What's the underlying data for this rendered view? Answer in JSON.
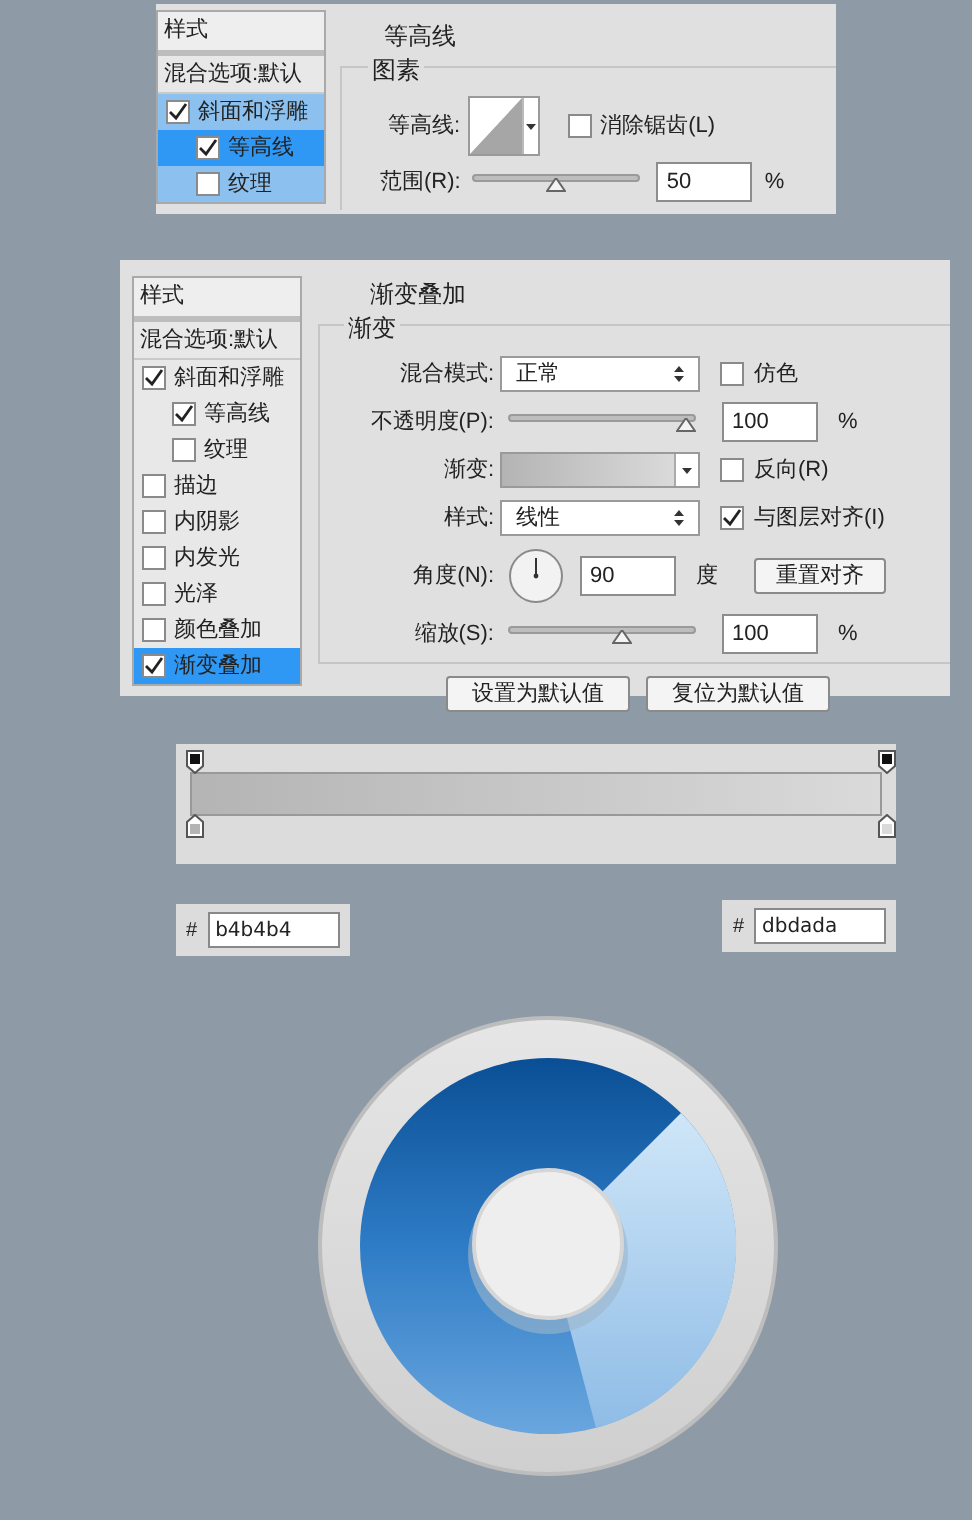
{
  "contour_panel": {
    "sidebar": [
      {
        "kind": "header",
        "label": "样式"
      },
      {
        "kind": "plain",
        "label": "混合选项:默认"
      },
      {
        "kind": "check",
        "label": "斜面和浮雕",
        "checked": true,
        "selected": false,
        "children": [
          {
            "kind": "check",
            "label": "等高线",
            "checked": true,
            "selected": true
          },
          {
            "kind": "check",
            "label": "纹理",
            "checked": false,
            "selected": false
          }
        ]
      }
    ],
    "title": "等高线",
    "group": "图素",
    "contour_label": "等高线:",
    "antialias": {
      "label": "消除锯齿(L)",
      "checked": false
    },
    "range": {
      "label": "范围(R):",
      "level": 0.5,
      "value": "50",
      "unit": "%"
    }
  },
  "gradient_panel": {
    "sidebar": [
      {
        "kind": "header",
        "label": "样式"
      },
      {
        "kind": "plain",
        "label": "混合选项:默认"
      },
      {
        "kind": "check",
        "label": "斜面和浮雕",
        "checked": true,
        "selected": false,
        "children": [
          {
            "kind": "check",
            "label": "等高线",
            "checked": true,
            "selected": false
          },
          {
            "kind": "check",
            "label": "纹理",
            "checked": false,
            "selected": false
          }
        ]
      },
      {
        "kind": "check",
        "label": "描边",
        "checked": false,
        "selected": false
      },
      {
        "kind": "check",
        "label": "内阴影",
        "checked": false,
        "selected": false
      },
      {
        "kind": "check",
        "label": "内发光",
        "checked": false,
        "selected": false
      },
      {
        "kind": "check",
        "label": "光泽",
        "checked": false,
        "selected": false
      },
      {
        "kind": "check",
        "label": "颜色叠加",
        "checked": false,
        "selected": false
      },
      {
        "kind": "check",
        "label": "渐变叠加",
        "checked": true,
        "selected": true
      }
    ],
    "title": "渐变叠加",
    "group": "渐变",
    "rows": [
      {
        "kind": "select",
        "label": "混合模式:",
        "value": "正常",
        "option": {
          "label": "仿色",
          "checked": false
        }
      },
      {
        "kind": "slider",
        "label": "不透明度(P):",
        "level": 1.0,
        "value": "100",
        "unit": "%"
      },
      {
        "kind": "gradient",
        "label": "渐变:",
        "option": {
          "label": "反向(R)",
          "checked": false
        }
      },
      {
        "kind": "select",
        "label": "样式:",
        "value": "线性",
        "option": {
          "label": "与图层对齐(I)",
          "checked": true
        }
      },
      {
        "kind": "dial",
        "label": "角度(N):",
        "value": "90",
        "unit": "度",
        "button": "重置对齐"
      },
      {
        "kind": "slider",
        "label": "缩放(S):",
        "level": 0.62,
        "value": "100",
        "unit": "%"
      }
    ],
    "buttons": [
      "设置为默认值",
      "复位为默认值"
    ]
  },
  "gradient_editor": {
    "stops": [
      {
        "hash": "#",
        "value": "b4b4b4"
      },
      {
        "hash": "#",
        "value": "dbdada"
      }
    ]
  }
}
